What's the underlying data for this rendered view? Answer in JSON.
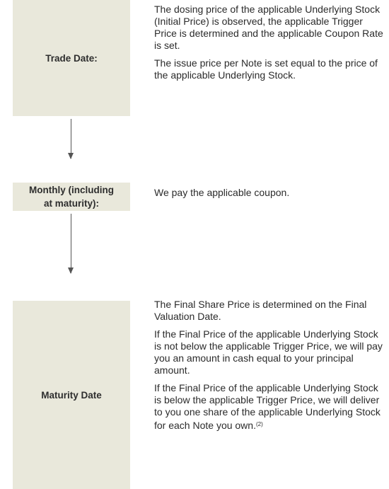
{
  "steps": [
    {
      "label": "Trade Date:",
      "paragraphs": [
        "The dosing price of the applicable Underlying Stock (Initial Price) is observed, the applicable Trigger Price is determined and the applicable Coupon Rate is set.",
        "The issue price per Note is set equal to the price of the applicable Underlying Stock."
      ]
    },
    {
      "label_line1": "Monthly (including",
      "label_line2": "at maturity):",
      "paragraphs": [
        "We pay the applicable coupon."
      ]
    },
    {
      "label": "Maturity Date",
      "paragraphs": [
        "The Final Share Price is determined on the Final Valuation Date.",
        "If the Final Price of the applicable Underlying Stock is not below the applicable Trigger Price, we will pay you an amount in cash equal to your principal amount.",
        "If the Final Price of the applicable Underlying Stock is below the applicable Trigger Price, we will deliver to you one share of the applicable Underlying Stock for each Note you own."
      ],
      "footnote_marker": "(2)"
    }
  ]
}
